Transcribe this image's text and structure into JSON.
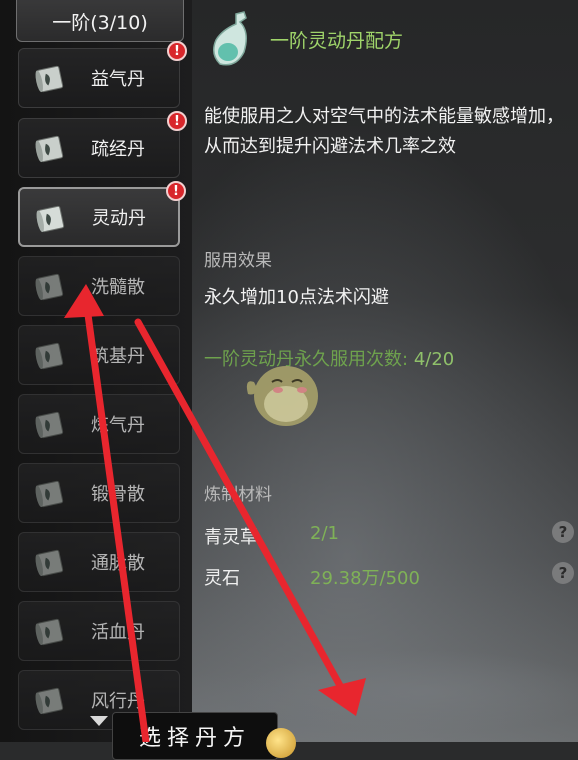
{
  "sidebar": {
    "tier_label": "一阶(3/10)",
    "items": [
      {
        "label": "益气丹",
        "badge": "!"
      },
      {
        "label": "疏经丹",
        "badge": "!"
      },
      {
        "label": "灵动丹",
        "badge": "!"
      },
      {
        "label": "洗髓散"
      },
      {
        "label": "筑基丹"
      },
      {
        "label": "炼气丹"
      },
      {
        "label": "锻骨散"
      },
      {
        "label": "通脉散"
      },
      {
        "label": "活血丹"
      },
      {
        "label": "风行丹"
      }
    ]
  },
  "detail": {
    "title": "一阶灵动丹配方",
    "description": "能使服用之人对空气中的法术能量敏感增加，从而达到提升闪避法术几率之效",
    "effect_heading": "服用效果",
    "effect_text": "永久增加10点法术闪避",
    "usage_label": "一阶灵动丹永久服用次数:",
    "usage_value": "4/20",
    "materials_heading": "炼制材料",
    "materials": [
      {
        "name": "青灵草",
        "qty": "2/1"
      },
      {
        "name": "灵石",
        "qty": "29.38万/500"
      }
    ],
    "help_glyph": "?"
  },
  "select_button": {
    "label": "选择丹方"
  },
  "colors": {
    "accent_green": "#9fd46a",
    "badge_red": "#d8262b",
    "arrow_red": "#e8262e"
  }
}
